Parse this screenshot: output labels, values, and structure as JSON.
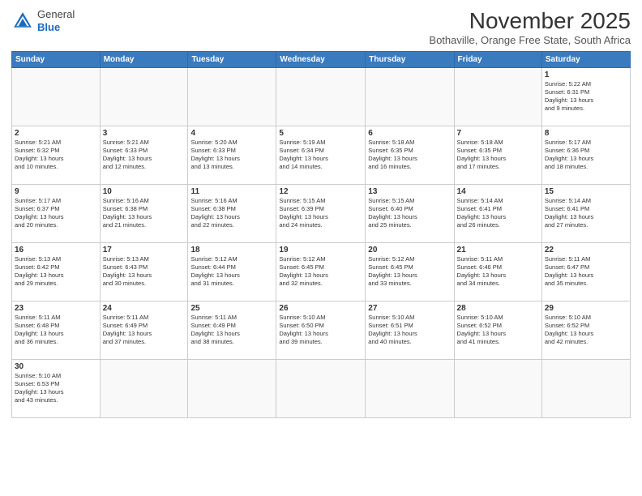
{
  "header": {
    "logo_general": "General",
    "logo_blue": "Blue",
    "month_title": "November 2025",
    "subtitle": "Bothaville, Orange Free State, South Africa"
  },
  "days_of_week": [
    "Sunday",
    "Monday",
    "Tuesday",
    "Wednesday",
    "Thursday",
    "Friday",
    "Saturday"
  ],
  "weeks": [
    [
      {
        "day": "",
        "info": ""
      },
      {
        "day": "",
        "info": ""
      },
      {
        "day": "",
        "info": ""
      },
      {
        "day": "",
        "info": ""
      },
      {
        "day": "",
        "info": ""
      },
      {
        "day": "",
        "info": ""
      },
      {
        "day": "1",
        "info": "Sunrise: 5:22 AM\nSunset: 6:31 PM\nDaylight: 13 hours\nand 9 minutes."
      }
    ],
    [
      {
        "day": "2",
        "info": "Sunrise: 5:21 AM\nSunset: 6:32 PM\nDaylight: 13 hours\nand 10 minutes."
      },
      {
        "day": "3",
        "info": "Sunrise: 5:21 AM\nSunset: 6:33 PM\nDaylight: 13 hours\nand 12 minutes."
      },
      {
        "day": "4",
        "info": "Sunrise: 5:20 AM\nSunset: 6:33 PM\nDaylight: 13 hours\nand 13 minutes."
      },
      {
        "day": "5",
        "info": "Sunrise: 5:19 AM\nSunset: 6:34 PM\nDaylight: 13 hours\nand 14 minutes."
      },
      {
        "day": "6",
        "info": "Sunrise: 5:18 AM\nSunset: 6:35 PM\nDaylight: 13 hours\nand 16 minutes."
      },
      {
        "day": "7",
        "info": "Sunrise: 5:18 AM\nSunset: 6:35 PM\nDaylight: 13 hours\nand 17 minutes."
      },
      {
        "day": "8",
        "info": "Sunrise: 5:17 AM\nSunset: 6:36 PM\nDaylight: 13 hours\nand 18 minutes."
      }
    ],
    [
      {
        "day": "9",
        "info": "Sunrise: 5:17 AM\nSunset: 6:37 PM\nDaylight: 13 hours\nand 20 minutes."
      },
      {
        "day": "10",
        "info": "Sunrise: 5:16 AM\nSunset: 6:38 PM\nDaylight: 13 hours\nand 21 minutes."
      },
      {
        "day": "11",
        "info": "Sunrise: 5:16 AM\nSunset: 6:38 PM\nDaylight: 13 hours\nand 22 minutes."
      },
      {
        "day": "12",
        "info": "Sunrise: 5:15 AM\nSunset: 6:39 PM\nDaylight: 13 hours\nand 24 minutes."
      },
      {
        "day": "13",
        "info": "Sunrise: 5:15 AM\nSunset: 6:40 PM\nDaylight: 13 hours\nand 25 minutes."
      },
      {
        "day": "14",
        "info": "Sunrise: 5:14 AM\nSunset: 6:41 PM\nDaylight: 13 hours\nand 26 minutes."
      },
      {
        "day": "15",
        "info": "Sunrise: 5:14 AM\nSunset: 6:41 PM\nDaylight: 13 hours\nand 27 minutes."
      }
    ],
    [
      {
        "day": "16",
        "info": "Sunrise: 5:13 AM\nSunset: 6:42 PM\nDaylight: 13 hours\nand 29 minutes."
      },
      {
        "day": "17",
        "info": "Sunrise: 5:13 AM\nSunset: 6:43 PM\nDaylight: 13 hours\nand 30 minutes."
      },
      {
        "day": "18",
        "info": "Sunrise: 5:12 AM\nSunset: 6:44 PM\nDaylight: 13 hours\nand 31 minutes."
      },
      {
        "day": "19",
        "info": "Sunrise: 5:12 AM\nSunset: 6:45 PM\nDaylight: 13 hours\nand 32 minutes."
      },
      {
        "day": "20",
        "info": "Sunrise: 5:12 AM\nSunset: 6:45 PM\nDaylight: 13 hours\nand 33 minutes."
      },
      {
        "day": "21",
        "info": "Sunrise: 5:11 AM\nSunset: 6:46 PM\nDaylight: 13 hours\nand 34 minutes."
      },
      {
        "day": "22",
        "info": "Sunrise: 5:11 AM\nSunset: 6:47 PM\nDaylight: 13 hours\nand 35 minutes."
      }
    ],
    [
      {
        "day": "23",
        "info": "Sunrise: 5:11 AM\nSunset: 6:48 PM\nDaylight: 13 hours\nand 36 minutes."
      },
      {
        "day": "24",
        "info": "Sunrise: 5:11 AM\nSunset: 6:49 PM\nDaylight: 13 hours\nand 37 minutes."
      },
      {
        "day": "25",
        "info": "Sunrise: 5:11 AM\nSunset: 6:49 PM\nDaylight: 13 hours\nand 38 minutes."
      },
      {
        "day": "26",
        "info": "Sunrise: 5:10 AM\nSunset: 6:50 PM\nDaylight: 13 hours\nand 39 minutes."
      },
      {
        "day": "27",
        "info": "Sunrise: 5:10 AM\nSunset: 6:51 PM\nDaylight: 13 hours\nand 40 minutes."
      },
      {
        "day": "28",
        "info": "Sunrise: 5:10 AM\nSunset: 6:52 PM\nDaylight: 13 hours\nand 41 minutes."
      },
      {
        "day": "29",
        "info": "Sunrise: 5:10 AM\nSunset: 6:52 PM\nDaylight: 13 hours\nand 42 minutes."
      }
    ],
    [
      {
        "day": "30",
        "info": "Sunrise: 5:10 AM\nSunset: 6:53 PM\nDaylight: 13 hours\nand 43 minutes."
      },
      {
        "day": "",
        "info": ""
      },
      {
        "day": "",
        "info": ""
      },
      {
        "day": "",
        "info": ""
      },
      {
        "day": "",
        "info": ""
      },
      {
        "day": "",
        "info": ""
      },
      {
        "day": "",
        "info": ""
      }
    ]
  ]
}
